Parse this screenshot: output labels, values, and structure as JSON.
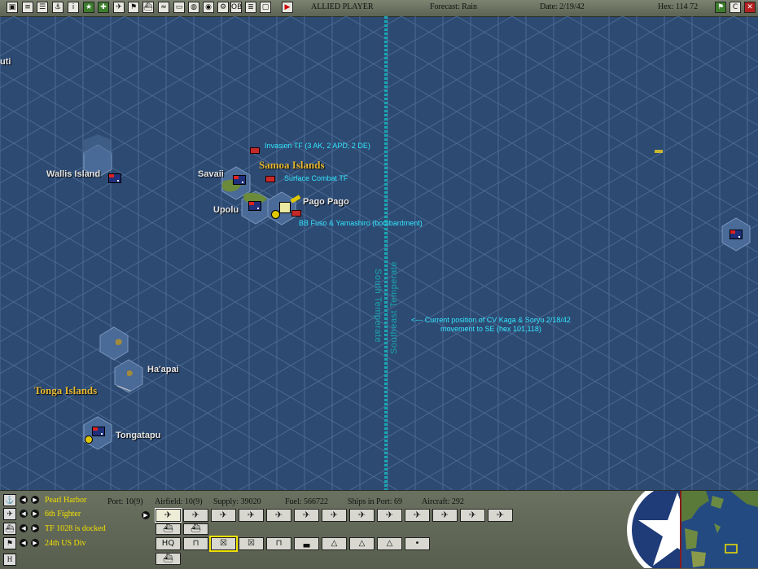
{
  "topbar": {
    "player": "ALLIED PLAYER",
    "forecast": "Forecast: Rain",
    "date": "Date: 2/19/42",
    "hex": "Hex: 114  72",
    "buttons": [
      "map-icon",
      "report-icon",
      "list-icon",
      "tf-icon",
      "info-icon",
      "star-icon",
      "plane-red-icon",
      "flag-icon",
      "ship-icon",
      "sub-icon",
      "base-icon",
      "globe-icon",
      "help-icon",
      "ob-icon",
      "doc-icon",
      "save-icon",
      "end-turn-icon"
    ],
    "right_buttons": [
      "flag-icon",
      "c-icon",
      "close-icon"
    ]
  },
  "map": {
    "places": {
      "tutuila_partial": "uti",
      "wallis": "Wallis Island",
      "savaii": "Savaii",
      "upolu": "Upolu",
      "pago_pago": "Pago Pago",
      "haapai": "Ha'apai",
      "tongatapu": "Tongatapu"
    },
    "regions": {
      "samoa": "Samoa Islands",
      "tonga": "Tonga Islands"
    },
    "notes": {
      "invasion": "Invasion TF (3 AK, 2 APD, 2 DE)",
      "surface": "Surface Combat TF",
      "fuso": "BB Fuso & Yamashiro (bombardment)",
      "carrier_line1": "<--- Current position of CV Kaga & Soryu 2/18/42",
      "carrier_line2": "movement to SE (hex 101,118)"
    },
    "weather": {
      "south": "South Temperate",
      "southeast": "Southeast Temperate"
    }
  },
  "bottom": {
    "rows": [
      {
        "icon": "anchor-icon",
        "label": "Pearl Harbor"
      },
      {
        "icon": "plane-icon",
        "label": "6th Fighter"
      },
      {
        "icon": "ship-icon",
        "label": "TF 1028 is docked"
      },
      {
        "icon": "flag-icon",
        "label": "24th US Div"
      }
    ],
    "stats": {
      "port": "Port: 10(9)",
      "airfield": "Airfield: 10(9)",
      "supply": "Supply: 39020",
      "fuel": "Fuel: 566722",
      "ships": "Ships in Port: 69",
      "aircraft": "Aircraft: 292"
    },
    "aircraft_slots": 13,
    "tf_buttons": [
      "HQ",
      "⊓",
      "☒",
      "☒",
      "⊓",
      "▃",
      "△",
      "△",
      "△",
      "•"
    ]
  },
  "colors": {
    "sea": "#2d4a72",
    "hex_line": "#4a6a94",
    "label_yellow": "#f0e000",
    "note_cyan": "#33e6ff",
    "region_gold": "#e8b830",
    "weather_line": "#1aa6b0",
    "allied_red": "#c42a2a"
  }
}
